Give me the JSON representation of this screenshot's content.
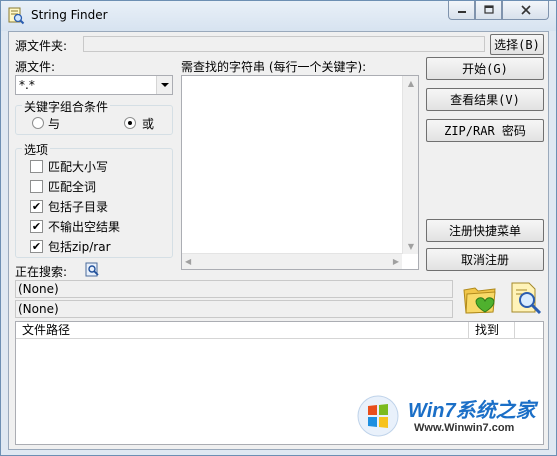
{
  "window": {
    "title": "String Finder"
  },
  "source_folder": {
    "label": "源文件夹:",
    "value": "",
    "browse_label": "选择(B)"
  },
  "source_file": {
    "label": "源文件:",
    "value": "*.*"
  },
  "keyword_box": {
    "label": "需查找的字符串 (每行一个关键字):",
    "value": ""
  },
  "combine": {
    "title": "关键字组合条件",
    "and_label": "与",
    "or_label": "或",
    "selected": "或"
  },
  "options": {
    "title": "选项",
    "items": [
      {
        "label": "匹配大小写",
        "checked": false
      },
      {
        "label": "匹配全词",
        "checked": false
      },
      {
        "label": "包括子目录",
        "checked": true
      },
      {
        "label": "不输出空结果",
        "checked": true
      },
      {
        "label": "包括zip/rar",
        "checked": true
      }
    ]
  },
  "buttons": {
    "start": "开始(G)",
    "view_results": "查看结果(V)",
    "zip_password": "ZIP/RAR 密码",
    "register_menu": "注册快捷菜单",
    "unregister": "取消注册"
  },
  "search_status": {
    "label": "正在搜索:",
    "line1": "(None)",
    "line2": "(None)"
  },
  "results": {
    "columns": [
      "文件路径",
      "找到"
    ],
    "rows": []
  },
  "watermark": {
    "brand": "Win7系统之家",
    "url": "Www.Winwin7.com"
  }
}
